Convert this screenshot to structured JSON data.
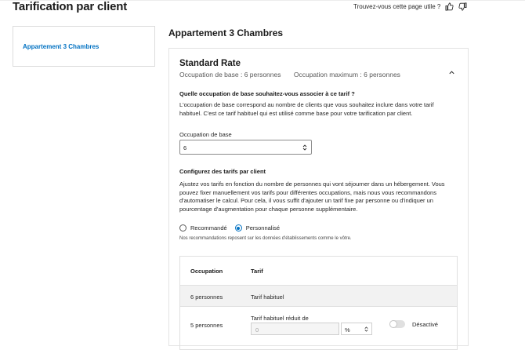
{
  "header": {
    "title": "Tarification par client",
    "feedback_question": "Trouvez-vous cette page utile ?",
    "thumbs_up_icon": "thumbs-up-icon",
    "thumbs_down_icon": "thumbs-down-icon"
  },
  "sidebar": {
    "items": [
      {
        "label": "Appartement 3 Chambres"
      }
    ]
  },
  "main": {
    "section_title": "Appartement 3 Chambres",
    "rate": {
      "name": "Standard Rate",
      "base_occupancy": "Occupation de base : 6 personnes",
      "max_occupancy": "Occupation maximum : 6 personnes",
      "collapse_icon": "chevron-up-icon"
    },
    "base_question": "Quelle occupation de base souhaitez-vous associer à ce tarif ?",
    "base_explanation": "L'occupation de base correspond au nombre de clients que vous souhaitez inclure dans votre tarif habituel. C'est ce tarif habituel qui est utilisé comme base pour votre tarification par client.",
    "base_field_label": "Occupation de base",
    "base_field_value": "6",
    "configure_title": "Configurez des tarifs par client",
    "configure_explanation": "Ajustez vos tarifs en fonction du nombre de personnes qui vont séjourner dans un hébergement. Vous pouvez fixer manuellement vos tarifs pour différentes occupations, mais nous vous recommandons d'automatiser le calcul. Pour cela, il vous suffit d'ajouter un tarif fixe par personne ou d'indiquer un pourcentage d'augmentation pour chaque personne supplémentaire.",
    "options": [
      {
        "label": "Recommandé",
        "selected": false
      },
      {
        "label": "Personnalisé",
        "selected": true
      }
    ],
    "recommendation_note": "Nos recommandations reposent sur les données d'établissements comme le vôtre.",
    "table": {
      "headers": [
        "Occupation",
        "Tarif"
      ],
      "rows": [
        {
          "occupation": "6 personnes",
          "rate": "Tarif habituel"
        },
        {
          "occupation": "5 personnes",
          "rate_label": "Tarif habituel réduit de",
          "value_placeholder": "0",
          "unit": "%",
          "toggle_label": "Désactivé",
          "toggle_on": false
        }
      ]
    },
    "colors": {
      "accent": "#0071c2",
      "text": "#262626",
      "border": "#e0e0e0"
    }
  }
}
